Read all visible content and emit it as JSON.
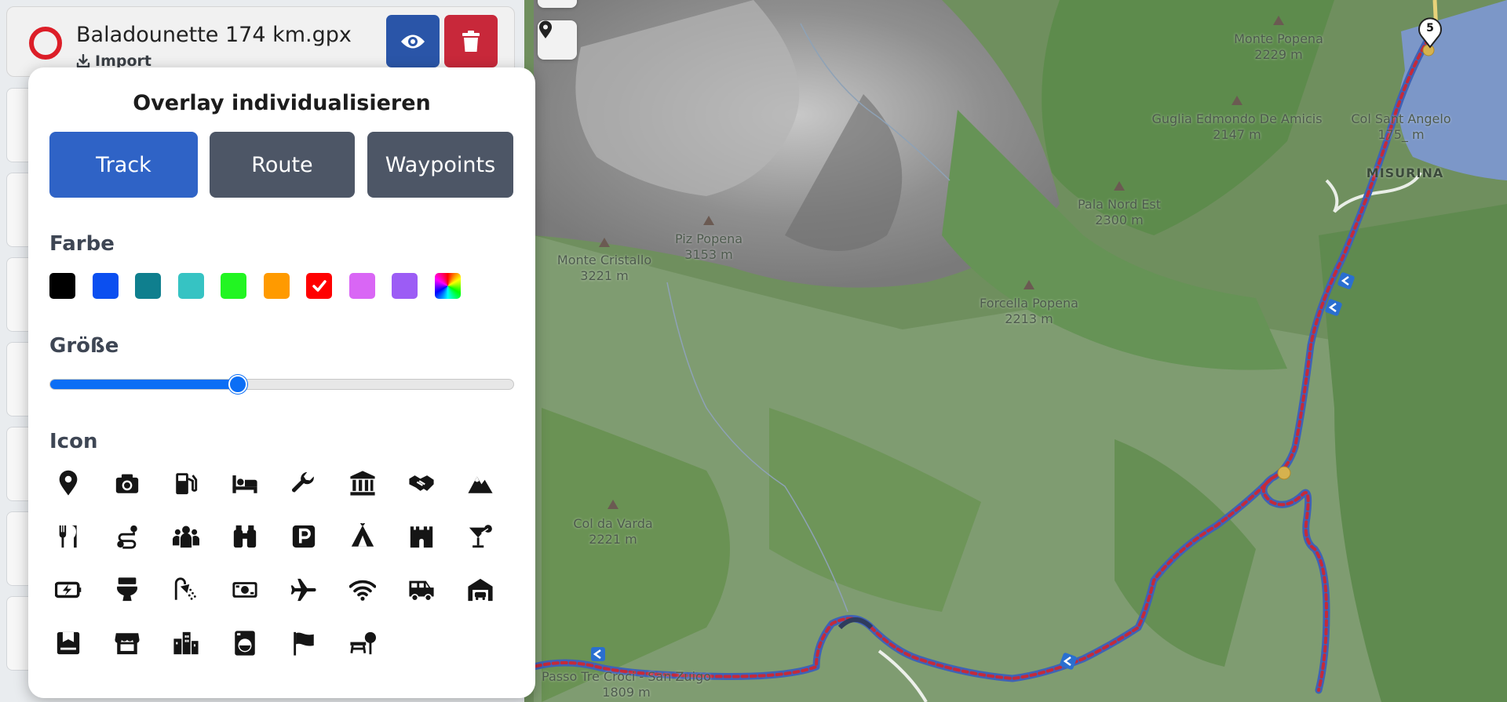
{
  "file": {
    "name": "Baladounette 174 km.gpx",
    "import_label": "Import"
  },
  "popover": {
    "title": "Overlay individualisieren",
    "tabs": [
      {
        "label": "Track",
        "active": true
      },
      {
        "label": "Route",
        "active": false
      },
      {
        "label": "Waypoints",
        "active": false
      }
    ],
    "color_label": "Farbe",
    "colors": [
      "#000000",
      "#0b4ff0",
      "#0f7f8e",
      "#36c3c3",
      "#22f522",
      "#ff9a00",
      "#ff0000",
      "#d966f5",
      "#9c5cf5",
      "rainbow"
    ],
    "selected_color": "#ff0000",
    "size_label": "Größe",
    "size_value": 0.405,
    "icon_label": "Icon",
    "icons": [
      "map-pin-icon",
      "camera-icon",
      "gas-pump-icon",
      "bed-icon",
      "wrench-icon",
      "museum-icon",
      "handshake-icon",
      "mountain-icon",
      "restaurant-icon",
      "route-icon",
      "people-group-icon",
      "binoculars-icon",
      "parking-icon",
      "tent-icon",
      "castle-icon",
      "cocktail-icon",
      "battery-charging-icon",
      "toilet-icon",
      "shower-icon",
      "money-bill-icon",
      "plane-icon",
      "wifi-icon",
      "camper-van-icon",
      "garage-icon",
      "box-icon",
      "shop-icon",
      "city-icon",
      "washing-machine-icon",
      "flag-icon",
      "picnic-icon"
    ]
  },
  "map": {
    "peaks": [
      {
        "name": "Monte Popena",
        "elevation": "2229 m"
      },
      {
        "name": "Guglia Edmondo De Amicis",
        "elevation": "2147 m"
      },
      {
        "name": "Col Sant Angelo",
        "elevation": "175_ m"
      },
      {
        "name": "Pala Nord Est",
        "elevation": "2300 m"
      },
      {
        "name": "Piz Popena",
        "elevation": "3153 m"
      },
      {
        "name": "Monte Cristallo",
        "elevation": "3221 m"
      },
      {
        "name": "Forcella Popena",
        "elevation": "2213 m"
      },
      {
        "name": "Col da Varda",
        "elevation": "2221 m"
      },
      {
        "name": "Passo Tre Croci - San Zuigo",
        "elevation": "1809 m"
      }
    ],
    "town": "MISURINA",
    "waypoint_number": "5"
  }
}
